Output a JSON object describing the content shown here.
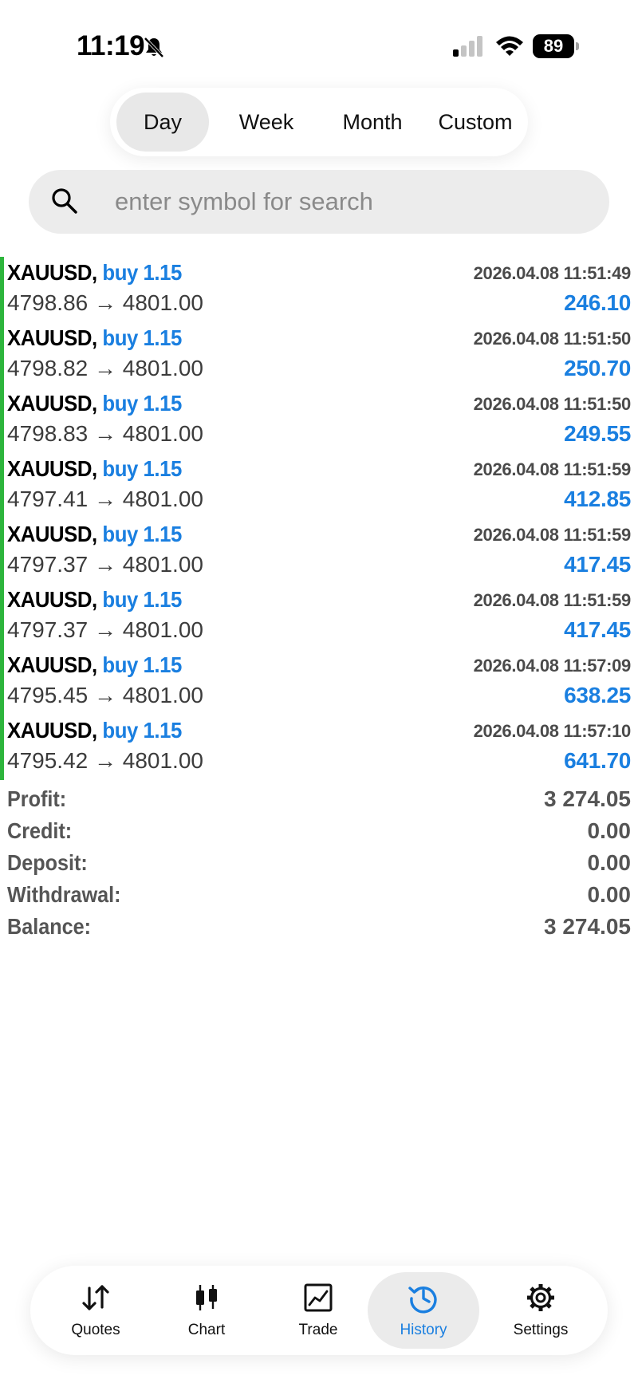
{
  "status_bar": {
    "time": "11:19",
    "battery": "89"
  },
  "period_tabs": [
    {
      "label": "Day",
      "active": true
    },
    {
      "label": "Week",
      "active": false
    },
    {
      "label": "Month",
      "active": false
    },
    {
      "label": "Custom",
      "active": false
    }
  ],
  "search": {
    "placeholder": "enter symbol for search",
    "value": ""
  },
  "trades": [
    {
      "symbol": "XAUUSD,",
      "side": "buy 1.15",
      "prices": "4798.86 → 4801.00",
      "time": "2026.04.08 11:51:49",
      "profit": "246.10"
    },
    {
      "symbol": "XAUUSD,",
      "side": "buy 1.15",
      "prices": "4798.82 → 4801.00",
      "time": "2026.04.08 11:51:50",
      "profit": "250.70"
    },
    {
      "symbol": "XAUUSD,",
      "side": "buy 1.15",
      "prices": "4798.83 → 4801.00",
      "time": "2026.04.08 11:51:50",
      "profit": "249.55"
    },
    {
      "symbol": "XAUUSD,",
      "side": "buy 1.15",
      "prices": "4797.41 → 4801.00",
      "time": "2026.04.08 11:51:59",
      "profit": "412.85"
    },
    {
      "symbol": "XAUUSD,",
      "side": "buy 1.15",
      "prices": "4797.37 → 4801.00",
      "time": "2026.04.08 11:51:59",
      "profit": "417.45"
    },
    {
      "symbol": "XAUUSD,",
      "side": "buy 1.15",
      "prices": "4797.37 → 4801.00",
      "time": "2026.04.08 11:51:59",
      "profit": "417.45"
    },
    {
      "symbol": "XAUUSD,",
      "side": "buy 1.15",
      "prices": "4795.45 → 4801.00",
      "time": "2026.04.08 11:57:09",
      "profit": "638.25"
    },
    {
      "symbol": "XAUUSD,",
      "side": "buy 1.15",
      "prices": "4795.42 → 4801.00",
      "time": "2026.04.08 11:57:10",
      "profit": "641.70"
    }
  ],
  "summary": [
    {
      "label": "Profit:",
      "value": "3 274.05"
    },
    {
      "label": "Credit:",
      "value": "0.00"
    },
    {
      "label": "Deposit:",
      "value": "0.00"
    },
    {
      "label": "Withdrawal:",
      "value": "0.00"
    },
    {
      "label": "Balance:",
      "value": "3 274.05"
    }
  ],
  "tab_bar": [
    {
      "label": "Quotes",
      "icon": "sort-arrows-icon",
      "active": false
    },
    {
      "label": "Chart",
      "icon": "candlestick-icon",
      "active": false
    },
    {
      "label": "Trade",
      "icon": "trade-chart-icon",
      "active": false
    },
    {
      "label": "History",
      "icon": "history-icon",
      "active": true
    },
    {
      "label": "Settings",
      "icon": "gear-icon",
      "active": false
    }
  ],
  "colors": {
    "accent": "#1a7fe0",
    "buy_bar": "#2db53c",
    "label_gray": "#555555"
  }
}
